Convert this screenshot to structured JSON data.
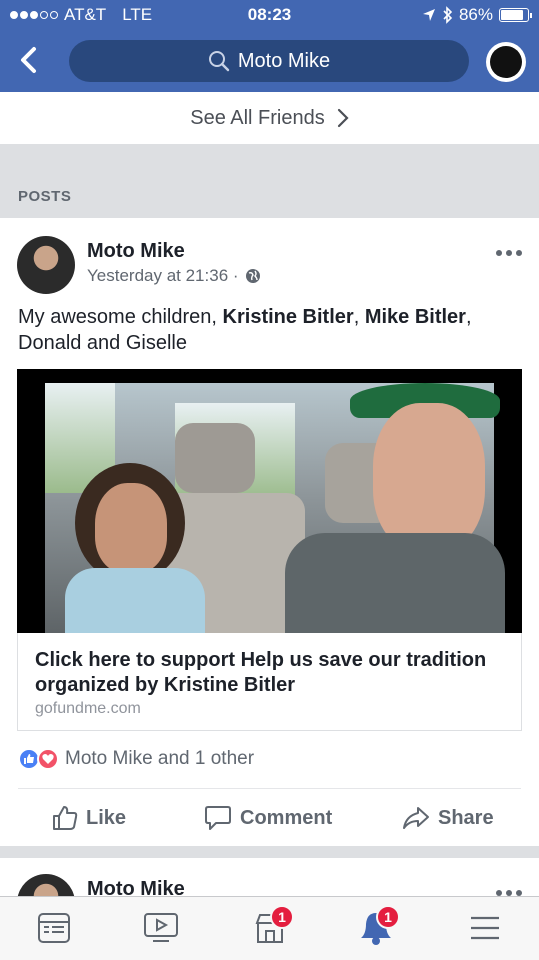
{
  "status_bar": {
    "carrier": "AT&T",
    "network": "LTE",
    "time": "08:23",
    "battery": "86%",
    "battery_level": 0.86
  },
  "header": {
    "search_text": "Moto Mike",
    "back_icon": "chevron-left-icon",
    "search_icon": "search-icon"
  },
  "friends": {
    "see_all_label": "See All Friends"
  },
  "section": {
    "posts_label": "POSTS"
  },
  "post": {
    "author": "Moto Mike",
    "timestamp": "Yesterday at 21:36 ·",
    "privacy_icon": "globe-icon",
    "text_prefix": "My awesome children, ",
    "tag1": "Kristine Bitler",
    "sep": ", ",
    "tag2": "Mike Bitler",
    "text_suffix": ", Donald and Giselle",
    "link": {
      "title": "Click here to support Help us save our tradition organized by Kristine Bitler",
      "domain": "gofundme.com"
    },
    "reactions_text": "Moto Mike and 1 other",
    "actions": {
      "like": "Like",
      "comment": "Comment",
      "share": "Share"
    }
  },
  "next_post": {
    "author": "Moto Mike"
  },
  "tabbar": {
    "marketplace_badge": "1",
    "notifications_badge": "1"
  },
  "colors": {
    "header_bg": "#4267b2",
    "search_bg": "#29487d",
    "accent": "#4267b2",
    "badge": "#e41e3f"
  }
}
